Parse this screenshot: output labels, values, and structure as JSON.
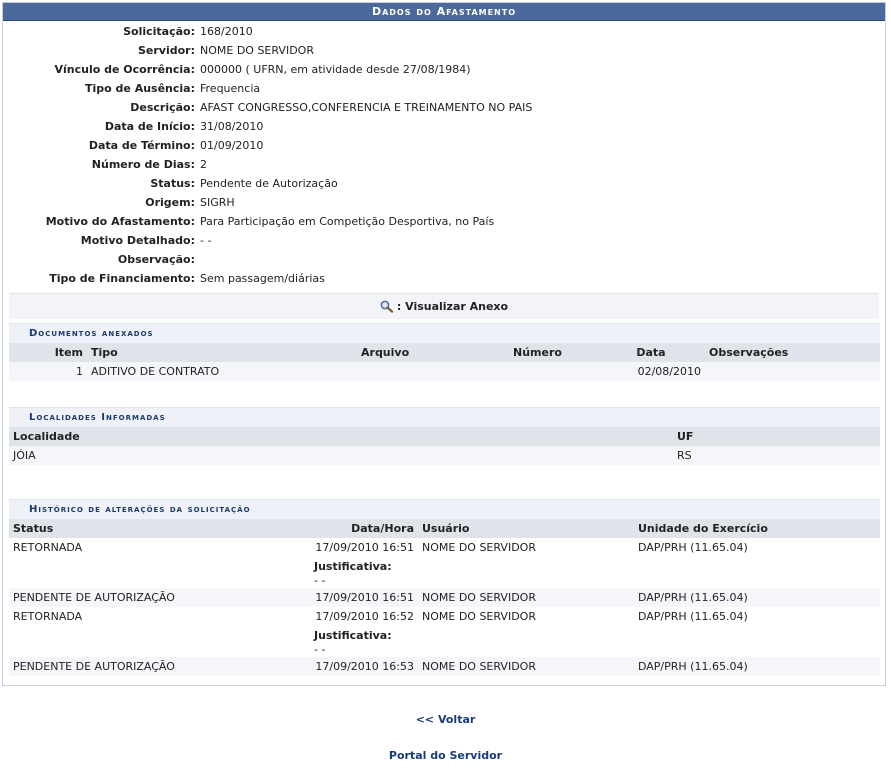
{
  "title": "Dados do Afastamento",
  "fields": [
    {
      "label": "Solicitação:",
      "value": "168/2010"
    },
    {
      "label": "Servidor:",
      "value": "NOME DO SERVIDOR"
    },
    {
      "label": "Vínculo de Ocorrência:",
      "value": "000000 ( UFRN, em atividade desde 27/08/1984)"
    },
    {
      "label": "Tipo de Ausência:",
      "value": "Frequencia"
    },
    {
      "label": "Descrição:",
      "value": "AFAST CONGRESSO,CONFERENCIA E TREINAMENTO NO PAIS"
    },
    {
      "label": "Data de Início:",
      "value": "31/08/2010"
    },
    {
      "label": "Data de Término:",
      "value": "01/09/2010"
    },
    {
      "label": "Número de Dias:",
      "value": "2"
    },
    {
      "label": "Status:",
      "value": "Pendente de Autorização"
    },
    {
      "label": "Origem:",
      "value": "SIGRH"
    },
    {
      "label": "Motivo do Afastamento:",
      "value": "Para Participação em Competição Desportiva, no País"
    },
    {
      "label": "Motivo Detalhado:",
      "value": "- -"
    },
    {
      "label": "Observação:",
      "value": ""
    },
    {
      "label": "Tipo de Financiamento:",
      "value": "Sem passagem/diárias"
    }
  ],
  "anexo_label": ": Visualizar Anexo",
  "documentos": {
    "title": "Documentos anexados",
    "headers": [
      "Item",
      "Tipo",
      "Arquivo",
      "Número",
      "Data",
      "Observações"
    ],
    "rows": [
      {
        "item": "1",
        "tipo": "ADITIVO DE CONTRATO",
        "arquivo": "",
        "numero": "",
        "data": "02/08/2010",
        "obs": ""
      }
    ]
  },
  "localidades": {
    "title": "Localidades Informadas",
    "headers": [
      "Localidade",
      "UF"
    ],
    "rows": [
      {
        "localidade": "JÓIA",
        "uf": "RS"
      }
    ]
  },
  "historico": {
    "title": "Histórico de alterações da solicitação",
    "headers": [
      "Status",
      "Data/Hora",
      "Usuário",
      "Unidade do Exercício"
    ],
    "justificativa_label": "Justificativa:",
    "rows": [
      {
        "status": "RETORNADA",
        "data": "17/09/2010 16:51",
        "usuario": "NOME DO SERVIDOR",
        "unidade": "DAP/PRH (11.65.04)",
        "justificativa": "- -"
      },
      {
        "status": "PENDENTE DE AUTORIZAÇÃO",
        "data": "17/09/2010 16:51",
        "usuario": "NOME DO SERVIDOR",
        "unidade": "DAP/PRH (11.65.04)"
      },
      {
        "status": "RETORNADA",
        "data": "17/09/2010 16:52",
        "usuario": "NOME DO SERVIDOR",
        "unidade": "DAP/PRH (11.65.04)",
        "justificativa": "- -"
      },
      {
        "status": "PENDENTE DE AUTORIZAÇÃO",
        "data": "17/09/2010 16:53",
        "usuario": "NOME DO SERVIDOR",
        "unidade": "DAP/PRH (11.65.04)"
      }
    ]
  },
  "links": {
    "voltar": "<< Voltar",
    "portal": "Portal do Servidor"
  }
}
